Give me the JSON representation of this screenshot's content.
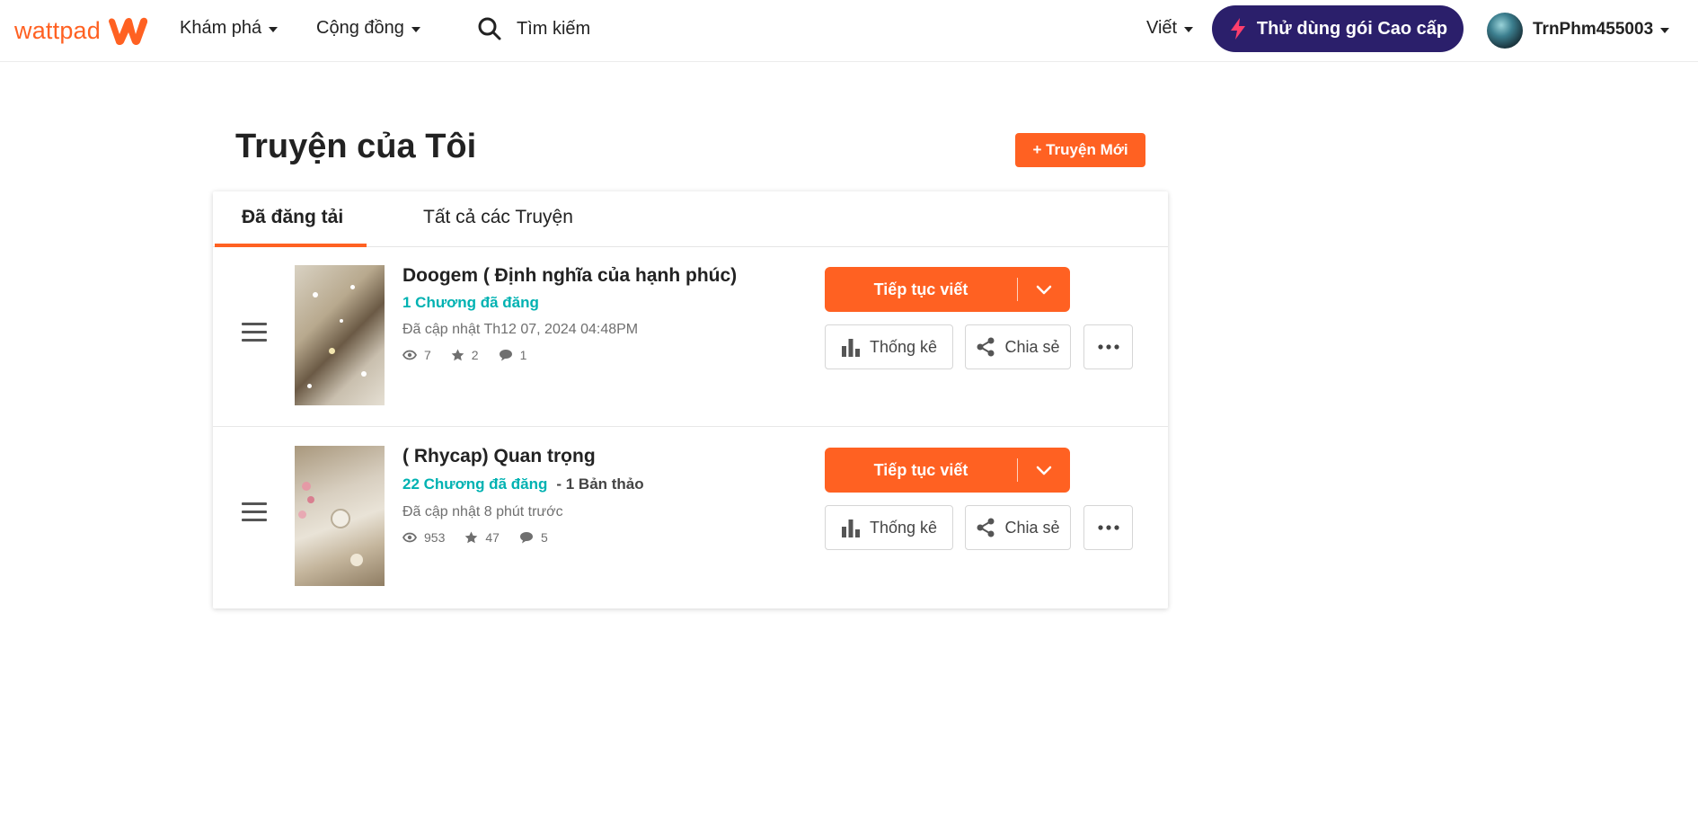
{
  "nav": {
    "logo_text": "wattpad",
    "explore": "Khám phá",
    "community": "Cộng đồng",
    "search_label": "Tìm kiếm",
    "write": "Viết",
    "premium": "Thử dùng gói Cao cấp",
    "username": "TrnPhm455003"
  },
  "page": {
    "title": "Truyện của Tôi",
    "new_story": "+ Truyện Mới"
  },
  "tabs": {
    "published": "Đã đăng tải",
    "all": "Tất cả các Truyện"
  },
  "stories": [
    {
      "title": "Doogem ( Định nghĩa của hạnh phúc)",
      "chapters": "1 Chương đã đăng",
      "drafts": "",
      "updated": "Đã cập nhật Th12 07, 2024 04:48PM",
      "views": "7",
      "votes": "2",
      "comments": "1"
    },
    {
      "title": "( Rhycap) Quan trọng",
      "chapters": "22 Chương đã đăng",
      "drafts": "-  1 Bản thảo",
      "updated": "Đã cập nhật 8 phút trước",
      "views": "953",
      "votes": "47",
      "comments": "5"
    }
  ],
  "actions": {
    "continue": "Tiếp tục viết",
    "stats": "Thống kê",
    "share": "Chia sẻ"
  },
  "colors": {
    "brand_orange": "#ff6122",
    "premium_purple": "#2b1f6b",
    "chapter_teal": "#00b2b2"
  }
}
